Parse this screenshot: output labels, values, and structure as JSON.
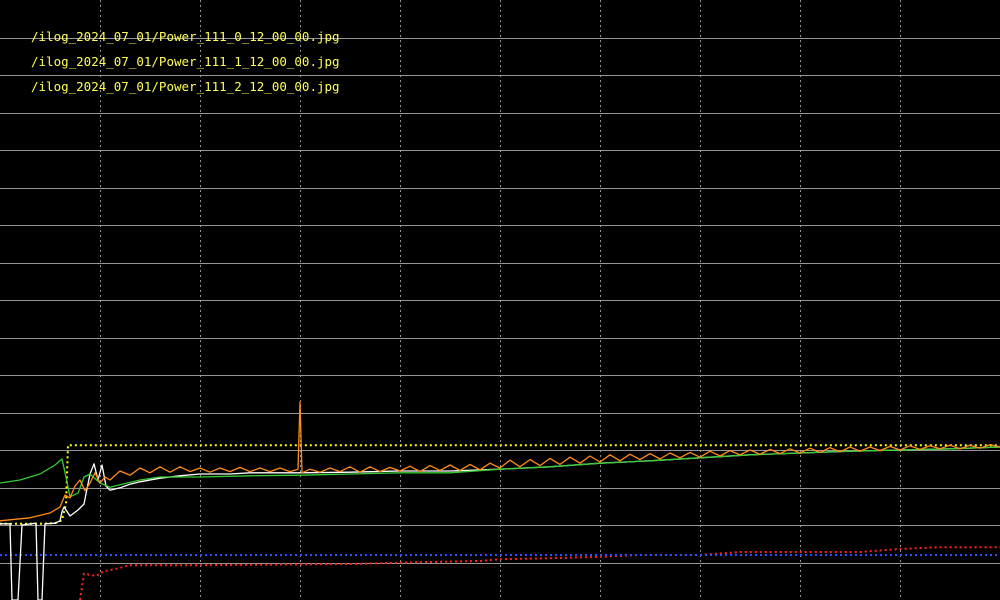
{
  "chart_data": {
    "type": "line",
    "background": "#000000",
    "grid": true,
    "grid_color": "#b0b0b0",
    "xlim": [
      0,
      1000
    ],
    "ylim": [
      0,
      1000
    ],
    "legend_placement": "top-left",
    "legend_entries": [
      {
        "label": "/ilog_2024_07_01/Power_111_0_12_00_00.jpg",
        "color": "#ffff55"
      },
      {
        "label": "/ilog_2024_07_01/Power_111_1_12_00_00.jpg",
        "color": "#ffff55"
      },
      {
        "label": "/ilog_2024_07_01/Power_111_2_12_00_00.jpg",
        "color": "#ffff55"
      }
    ],
    "series": [
      {
        "color": "#ffff00",
        "style": "dotted",
        "points": [
          [
            0,
            127
          ],
          [
            38,
            127
          ],
          [
            55,
            128
          ],
          [
            62,
            133
          ],
          [
            66,
            160
          ],
          [
            68,
            258
          ],
          [
            68,
            258
          ],
          [
            1000,
            258
          ]
        ]
      },
      {
        "color": "#ff2020",
        "style": "dotted",
        "points": [
          [
            80,
            0
          ],
          [
            84,
            44
          ],
          [
            96,
            40
          ],
          [
            104,
            48
          ],
          [
            116,
            52
          ],
          [
            130,
            58
          ],
          [
            200,
            58
          ],
          [
            350,
            60
          ],
          [
            420,
            63
          ],
          [
            480,
            65
          ],
          [
            500,
            68
          ],
          [
            560,
            70
          ],
          [
            600,
            72
          ],
          [
            640,
            75
          ],
          [
            700,
            75
          ],
          [
            740,
            80
          ],
          [
            800,
            80
          ],
          [
            860,
            80
          ],
          [
            900,
            85
          ],
          [
            940,
            88
          ],
          [
            1000,
            88
          ]
        ]
      },
      {
        "color": "#3050ff",
        "style": "dotted",
        "points": [
          [
            0,
            75
          ],
          [
            1000,
            75
          ]
        ]
      },
      {
        "color": "#ffffff",
        "style": "solid",
        "points": [
          [
            0,
            127
          ],
          [
            10,
            127
          ],
          [
            12,
            0
          ],
          [
            18,
            0
          ],
          [
            22,
            125
          ],
          [
            36,
            128
          ],
          [
            38,
            0
          ],
          [
            42,
            0
          ],
          [
            45,
            127
          ],
          [
            55,
            128
          ],
          [
            60,
            132
          ],
          [
            62,
            147
          ],
          [
            64,
            155
          ],
          [
            70,
            140
          ],
          [
            78,
            150
          ],
          [
            84,
            160
          ],
          [
            90,
            210
          ],
          [
            94,
            227
          ],
          [
            98,
            200
          ],
          [
            102,
            225
          ],
          [
            106,
            190
          ],
          [
            110,
            183
          ],
          [
            120,
            187
          ],
          [
            130,
            193
          ],
          [
            140,
            197
          ],
          [
            160,
            203
          ],
          [
            180,
            207
          ],
          [
            200,
            210
          ],
          [
            230,
            210
          ],
          [
            250,
            212
          ],
          [
            280,
            212
          ],
          [
            300,
            212
          ],
          [
            350,
            213
          ],
          [
            400,
            215
          ],
          [
            450,
            215
          ],
          [
            500,
            218
          ],
          [
            550,
            222
          ],
          [
            600,
            228
          ],
          [
            650,
            232
          ],
          [
            700,
            237
          ],
          [
            750,
            242
          ],
          [
            800,
            245
          ],
          [
            850,
            248
          ],
          [
            900,
            250
          ],
          [
            950,
            252
          ],
          [
            1000,
            255
          ]
        ]
      },
      {
        "color": "#33cc33",
        "style": "solid",
        "points": [
          [
            0,
            195
          ],
          [
            20,
            200
          ],
          [
            40,
            210
          ],
          [
            55,
            225
          ],
          [
            62,
            235
          ],
          [
            66,
            205
          ],
          [
            70,
            172
          ],
          [
            78,
            178
          ],
          [
            84,
            205
          ],
          [
            90,
            210
          ],
          [
            100,
            195
          ],
          [
            110,
            188
          ],
          [
            120,
            192
          ],
          [
            140,
            200
          ],
          [
            160,
            205
          ],
          [
            200,
            205
          ],
          [
            250,
            207
          ],
          [
            300,
            208
          ],
          [
            350,
            210
          ],
          [
            400,
            212
          ],
          [
            450,
            212
          ],
          [
            500,
            218
          ],
          [
            550,
            222
          ],
          [
            600,
            228
          ],
          [
            650,
            232
          ],
          [
            700,
            237
          ],
          [
            750,
            242
          ],
          [
            800,
            245
          ],
          [
            850,
            248
          ],
          [
            900,
            250
          ],
          [
            950,
            252
          ],
          [
            1000,
            255
          ]
        ]
      },
      {
        "color": "#ff8c1a",
        "style": "solid",
        "points": [
          [
            0,
            132
          ],
          [
            30,
            137
          ],
          [
            50,
            145
          ],
          [
            60,
            155
          ],
          [
            65,
            175
          ],
          [
            70,
            170
          ],
          [
            75,
            190
          ],
          [
            80,
            200
          ],
          [
            85,
            182
          ],
          [
            90,
            195
          ],
          [
            95,
            212
          ],
          [
            100,
            195
          ],
          [
            105,
            205
          ],
          [
            110,
            200
          ],
          [
            120,
            215
          ],
          [
            130,
            208
          ],
          [
            140,
            220
          ],
          [
            150,
            212
          ],
          [
            160,
            222
          ],
          [
            170,
            213
          ],
          [
            180,
            222
          ],
          [
            190,
            214
          ],
          [
            200,
            220
          ],
          [
            210,
            213
          ],
          [
            220,
            220
          ],
          [
            230,
            214
          ],
          [
            240,
            221
          ],
          [
            250,
            214
          ],
          [
            260,
            220
          ],
          [
            270,
            214
          ],
          [
            280,
            220
          ],
          [
            290,
            214
          ],
          [
            298,
            218
          ],
          [
            300,
            330
          ],
          [
            302,
            212
          ],
          [
            310,
            218
          ],
          [
            320,
            213
          ],
          [
            330,
            220
          ],
          [
            340,
            214
          ],
          [
            350,
            222
          ],
          [
            360,
            213
          ],
          [
            370,
            222
          ],
          [
            380,
            214
          ],
          [
            390,
            221
          ],
          [
            400,
            215
          ],
          [
            410,
            223
          ],
          [
            420,
            214
          ],
          [
            430,
            224
          ],
          [
            440,
            216
          ],
          [
            450,
            225
          ],
          [
            460,
            216
          ],
          [
            470,
            226
          ],
          [
            480,
            217
          ],
          [
            490,
            228
          ],
          [
            500,
            220
          ],
          [
            510,
            233
          ],
          [
            520,
            222
          ],
          [
            530,
            234
          ],
          [
            540,
            224
          ],
          [
            550,
            236
          ],
          [
            560,
            226
          ],
          [
            570,
            238
          ],
          [
            580,
            228
          ],
          [
            590,
            240
          ],
          [
            600,
            230
          ],
          [
            610,
            242
          ],
          [
            620,
            232
          ],
          [
            630,
            243
          ],
          [
            640,
            234
          ],
          [
            650,
            244
          ],
          [
            660,
            235
          ],
          [
            670,
            245
          ],
          [
            680,
            237
          ],
          [
            690,
            246
          ],
          [
            700,
            238
          ],
          [
            710,
            248
          ],
          [
            720,
            240
          ],
          [
            730,
            249
          ],
          [
            740,
            242
          ],
          [
            750,
            250
          ],
          [
            760,
            243
          ],
          [
            770,
            251
          ],
          [
            780,
            244
          ],
          [
            790,
            252
          ],
          [
            800,
            245
          ],
          [
            810,
            253
          ],
          [
            820,
            246
          ],
          [
            830,
            254
          ],
          [
            840,
            247
          ],
          [
            850,
            255
          ],
          [
            860,
            248
          ],
          [
            870,
            255
          ],
          [
            880,
            249
          ],
          [
            890,
            256
          ],
          [
            900,
            250
          ],
          [
            910,
            257
          ],
          [
            920,
            251
          ],
          [
            930,
            257
          ],
          [
            940,
            252
          ],
          [
            950,
            258
          ],
          [
            960,
            252
          ],
          [
            970,
            258
          ],
          [
            980,
            253
          ],
          [
            990,
            259
          ],
          [
            1000,
            255
          ]
        ]
      }
    ]
  }
}
